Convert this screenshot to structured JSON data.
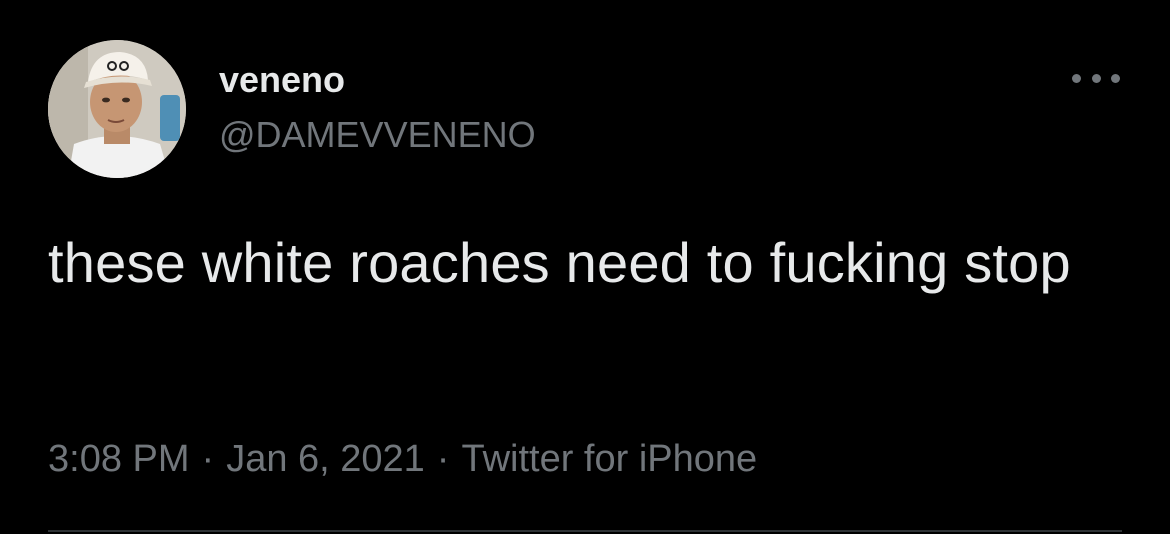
{
  "tweet": {
    "display_name": "veneno",
    "handle": "@DAMEVVENENO",
    "text": "these white roaches need to fucking stop",
    "time": "3:08 PM",
    "separator": "·",
    "date": "Jan 6, 2021",
    "source": "Twitter for iPhone"
  },
  "icons": {
    "more": "more-horizontal-icon",
    "avatar": "profile-photo"
  },
  "colors": {
    "background": "#000000",
    "primary_text": "#e7e9ea",
    "secondary_text": "#71767b",
    "divider": "#2f3336"
  }
}
